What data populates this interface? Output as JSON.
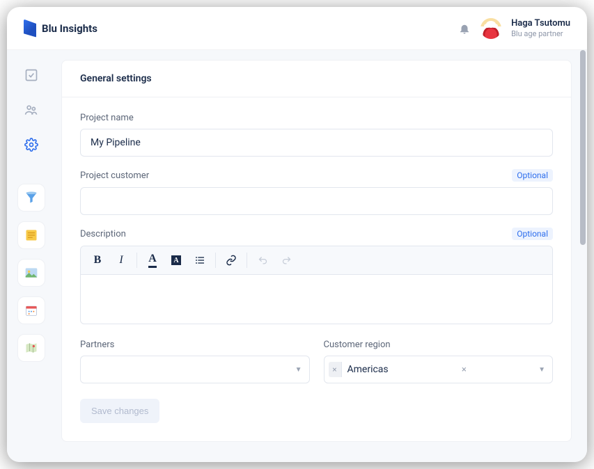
{
  "brand": "Blu Insights",
  "user": {
    "name": "Haga Tsutomu",
    "subtitle": "Blu age partner"
  },
  "page": {
    "title": "General settings",
    "fields": {
      "project_name": {
        "label": "Project name",
        "value": "My Pipeline"
      },
      "project_customer": {
        "label": "Project customer",
        "badge": "Optional",
        "value": ""
      },
      "description": {
        "label": "Description",
        "badge": "Optional"
      },
      "partners": {
        "label": "Partners"
      },
      "customer_region": {
        "label": "Customer region",
        "selected": "Americas"
      }
    },
    "save_label": "Save changes"
  }
}
